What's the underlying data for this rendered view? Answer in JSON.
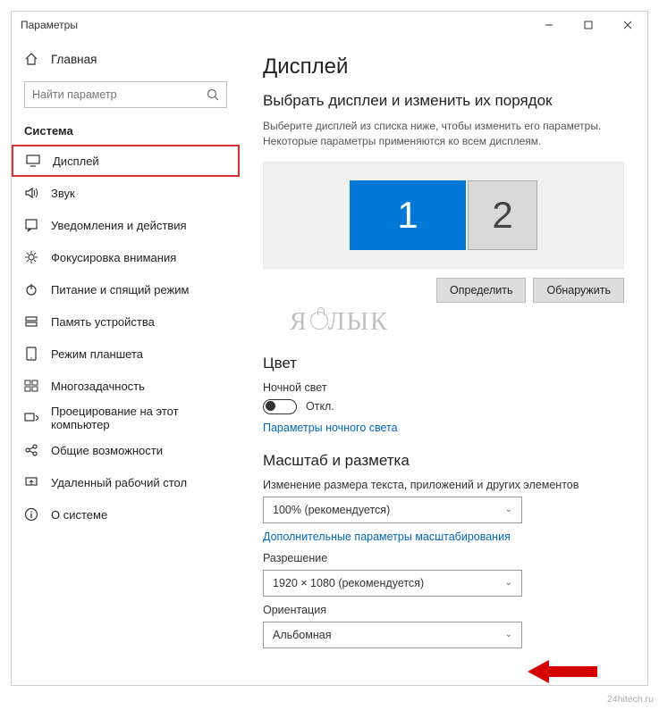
{
  "window": {
    "title": "Параметры"
  },
  "sidebar": {
    "home": "Главная",
    "search_placeholder": "Найти параметр",
    "section": "Система",
    "items": [
      {
        "label": "Дисплей",
        "icon": "display-icon",
        "active": true
      },
      {
        "label": "Звук",
        "icon": "sound-icon"
      },
      {
        "label": "Уведомления и действия",
        "icon": "notifications-icon"
      },
      {
        "label": "Фокусировка внимания",
        "icon": "focus-icon"
      },
      {
        "label": "Питание и спящий режим",
        "icon": "power-icon"
      },
      {
        "label": "Память устройства",
        "icon": "storage-icon"
      },
      {
        "label": "Режим планшета",
        "icon": "tablet-icon"
      },
      {
        "label": "Многозадачность",
        "icon": "multitask-icon"
      },
      {
        "label": "Проецирование на этот компьютер",
        "icon": "projecting-icon"
      },
      {
        "label": "Общие возможности",
        "icon": "shared-icon"
      },
      {
        "label": "Удаленный рабочий стол",
        "icon": "remote-icon"
      },
      {
        "label": "О системе",
        "icon": "about-icon"
      }
    ]
  },
  "content": {
    "h1": "Дисплей",
    "select_heading": "Выбрать дисплеи и изменить их порядок",
    "select_desc": "Выберите дисплей из списка ниже, чтобы изменить его параметры. Некоторые параметры применяются ко всем дисплеям.",
    "mon1": "1",
    "mon2": "2",
    "identify": "Определить",
    "detect": "Обнаружить",
    "logo": "Я  ЛЫК",
    "color_h": "Цвет",
    "night_label": "Ночной свет",
    "night_state": "Откл.",
    "night_link": "Параметры ночного света",
    "scale_h": "Масштаб и разметка",
    "scale_label": "Изменение размера текста, приложений и других элементов",
    "scale_value": "100% (рекомендуется)",
    "scale_link": "Дополнительные параметры масштабирования",
    "res_label": "Разрешение",
    "res_value": "1920 × 1080 (рекомендуется)",
    "orient_label": "Ориентация",
    "orient_value": "Альбомная"
  },
  "watermark": "24hitech.ru"
}
